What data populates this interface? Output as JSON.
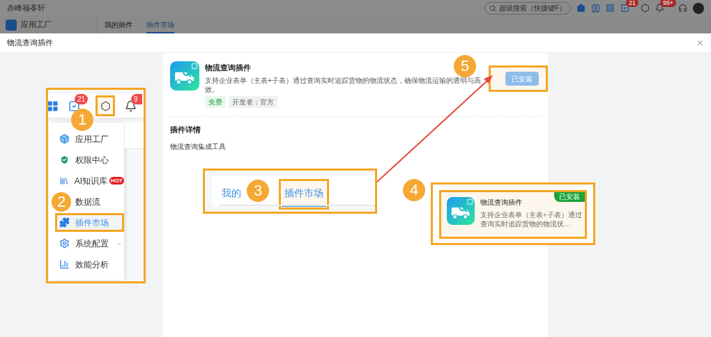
{
  "app": {
    "title": "赤峰福苓轩",
    "search": {
      "placeholder": "超级搜索（快捷键F）"
    },
    "badges": [
      "21",
      "99+"
    ],
    "sidebar": {
      "items": [
        {
          "label": "应用工厂"
        }
      ]
    },
    "tabs": [
      {
        "label": "我的插件",
        "selected": false
      },
      {
        "label": "插件市场",
        "selected": true
      }
    ]
  },
  "modal": {
    "title": "物流查询插件",
    "plugin": {
      "name": "物流查询插件",
      "description": "支持企业表单（主表+子表）通过查询实时追踪货物的物流状态，确保物流运输的透明与高效。",
      "tags": [
        {
          "label": "免费",
          "kind": "price"
        },
        {
          "label": "开发者：官方",
          "kind": "developer"
        }
      ],
      "button": {
        "label": "已安装",
        "disabled": true
      }
    },
    "details": {
      "title": "插件详情",
      "text": "物流查询集成工具"
    }
  },
  "annotations": {
    "steps": [
      "1",
      "2",
      "3",
      "4",
      "5"
    ],
    "menu_inset": {
      "toolbar_badges": [
        "21",
        "9"
      ],
      "items": [
        {
          "label": "应用工厂",
          "kind": "cube",
          "selected": false
        },
        {
          "label": "权限中心",
          "kind": "shield",
          "selected": false
        },
        {
          "label": "AI知识库",
          "kind": "books",
          "selected": false,
          "hot": "HOT"
        },
        {
          "label": "数据流",
          "kind": "plain",
          "selected": false
        },
        {
          "label": "插件市场",
          "kind": "puzzle",
          "selected": true
        },
        {
          "label": "系统配置",
          "kind": "gear",
          "selected": false,
          "expandable": true
        },
        {
          "label": "效能分析",
          "kind": "chart",
          "selected": false
        }
      ]
    },
    "tabs_inset": {
      "tabs": [
        {
          "label": "我的",
          "selected": false
        },
        {
          "label": "插件市场",
          "selected": true
        }
      ]
    },
    "card_inset": {
      "name": "物流查询插件",
      "description": "支持企业表单（主表+子表）通过查询实时追踪货物的物流状…",
      "status": "已安装"
    }
  }
}
